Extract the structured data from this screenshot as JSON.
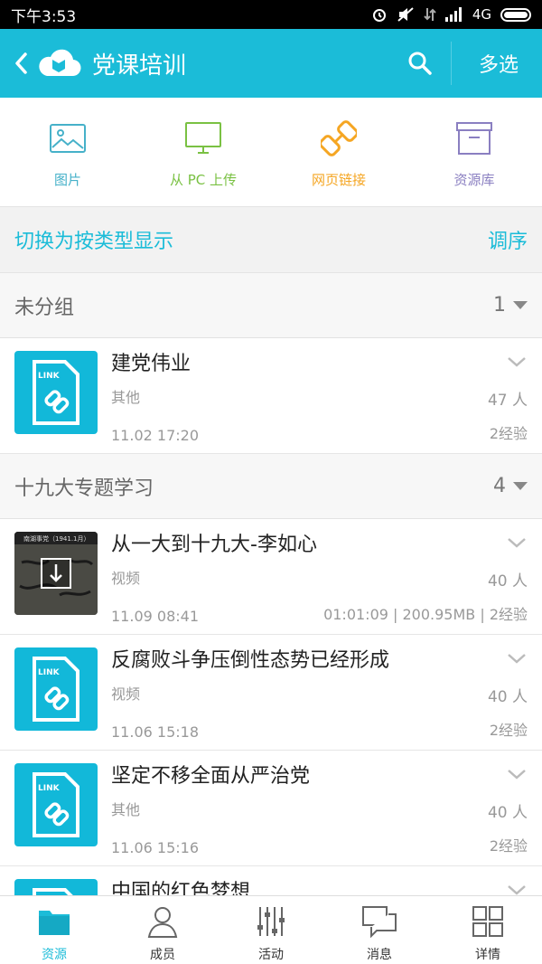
{
  "status_bar": {
    "time": "下午3:53",
    "network": "4G"
  },
  "header": {
    "title": "党课培训",
    "multi_select": "多选",
    "back_icon": "back-arrow-icon",
    "search_icon": "search-icon"
  },
  "uploads": [
    {
      "label": "图片",
      "icon": "image-icon",
      "color": "#46b1c9"
    },
    {
      "label": "从 PC 上传",
      "icon": "monitor-icon",
      "color": "#7ac143"
    },
    {
      "label": "网页链接",
      "icon": "link-icon",
      "color": "#f5a623"
    },
    {
      "label": "资源库",
      "icon": "archive-box-icon",
      "color": "#8a7fc1"
    }
  ],
  "switch_bar": {
    "toggle_label": "切换为按类型显示",
    "reorder_label": "调序"
  },
  "groups": [
    {
      "name": "未分组",
      "count": "1",
      "items": [
        {
          "title": "建党伟业",
          "category": "其他",
          "date": "11.02 17:20",
          "views": "47 人",
          "meta": "2经验",
          "thumb": "link"
        }
      ]
    },
    {
      "name": "十九大专题学习",
      "count": "4",
      "items": [
        {
          "title": "从一大到十九大-李如心",
          "category": "视频",
          "date": "11.09 08:41",
          "views": "40 人",
          "meta": "01:01:09 | 200.95MB | 2经验",
          "thumb": "video",
          "video_caption": "南湖事党（1941.1月）"
        },
        {
          "title": "反腐败斗争压倒性态势已经形成",
          "category": "视频",
          "date": "11.06 15:18",
          "views": "40 人",
          "meta": "2经验",
          "thumb": "link"
        },
        {
          "title": "坚定不移全面从严治党",
          "category": "其他",
          "date": "11.06 15:16",
          "views": "40 人",
          "meta": "2经验",
          "thumb": "link"
        },
        {
          "title": "中国的红色梦想",
          "category": "",
          "date": "",
          "views": "",
          "meta": "",
          "thumb": "link"
        }
      ]
    }
  ],
  "bottom_nav": [
    {
      "label": "资源",
      "icon": "folder-icon",
      "active": true
    },
    {
      "label": "成员",
      "icon": "person-icon",
      "active": false
    },
    {
      "label": "活动",
      "icon": "sliders-icon",
      "active": false
    },
    {
      "label": "消息",
      "icon": "chat-icon",
      "active": false
    },
    {
      "label": "详情",
      "icon": "grid-icon",
      "active": false
    }
  ],
  "colors": {
    "accent": "#1bbcd8",
    "thumb": "#12b8d9"
  },
  "link_badge": "LINK"
}
